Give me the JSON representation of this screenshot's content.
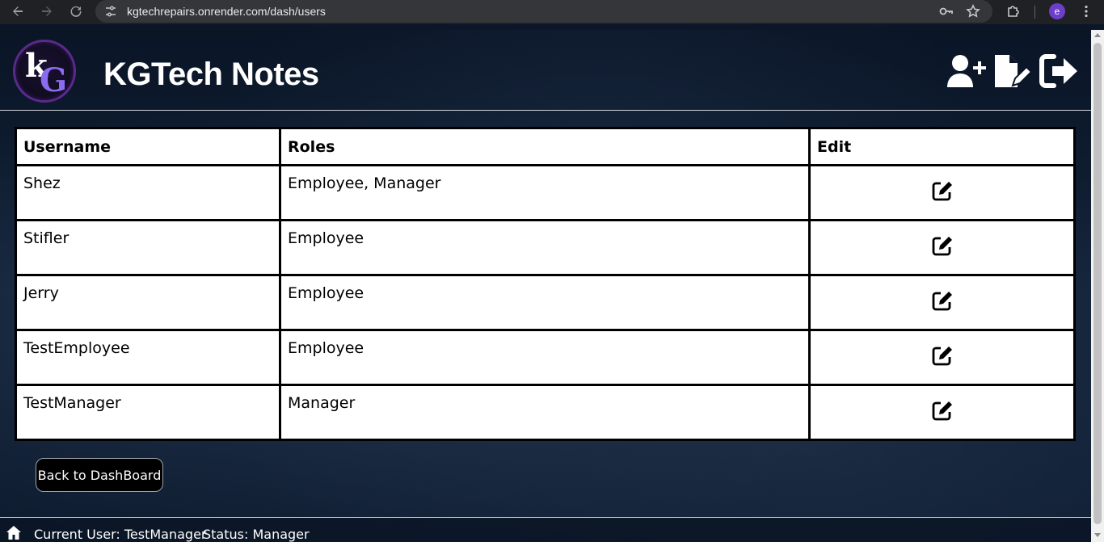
{
  "browser": {
    "url": "kgtechrepairs.onrender.com/dash/users",
    "profile_initial": "e"
  },
  "header": {
    "logo_k": "k",
    "logo_g": "G",
    "title": "KGTech Notes",
    "actions": [
      {
        "icon": "user-plus-icon"
      },
      {
        "icon": "file-pen-icon"
      },
      {
        "icon": "logout-icon"
      }
    ]
  },
  "table": {
    "headers": {
      "username": "Username",
      "roles": "Roles",
      "edit": "Edit"
    },
    "rows": [
      {
        "username": "Shez",
        "roles": "Employee, Manager"
      },
      {
        "username": "Stifler",
        "roles": "Employee"
      },
      {
        "username": "Jerry",
        "roles": "Employee"
      },
      {
        "username": "TestEmployee",
        "roles": "Employee"
      },
      {
        "username": "TestManager",
        "roles": "Manager"
      }
    ]
  },
  "back_button": "Back to DashBoard",
  "footer": {
    "current_user": "Current User: TestManager",
    "status": "Status: Manager"
  }
}
